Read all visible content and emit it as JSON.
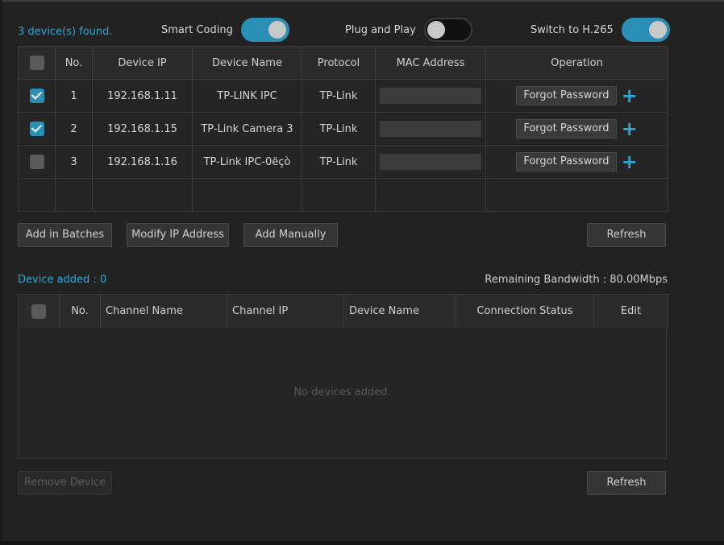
{
  "header": {
    "found_text": "3 device(s) found.",
    "toggles": [
      {
        "label": "Smart Coding",
        "state": "on"
      },
      {
        "label": "Plug and Play",
        "state": "off"
      },
      {
        "label": "Switch to H.265",
        "state": "on"
      }
    ]
  },
  "found_table": {
    "columns": [
      "No.",
      "Device IP",
      "Device Name",
      "Protocol",
      "MAC Address",
      "Operation"
    ],
    "rows": [
      {
        "checked": true,
        "no": "1",
        "ip": "192.168.1.11",
        "name": "TP-LINK IPC",
        "protocol": "TP-Link",
        "operation": "Forgot Password"
      },
      {
        "checked": true,
        "no": "2",
        "ip": "192.168.1.15",
        "name": "TP-Link Camera 3",
        "protocol": "TP-Link",
        "operation": "Forgot Password"
      },
      {
        "checked": false,
        "no": "3",
        "ip": "192.168.1.16",
        "name": "TP-Link IPC-0ëçò",
        "protocol": "TP-Link",
        "operation": "Forgot Password"
      }
    ]
  },
  "actions": {
    "add_batches": "Add in Batches",
    "modify_ip": "Modify IP Address",
    "add_manually": "Add Manually",
    "refresh": "Refresh"
  },
  "added_section": {
    "title": "Device added : 0",
    "bandwidth": "Remaining Bandwidth : 80.00Mbps",
    "columns": [
      "No.",
      "Channel Name",
      "Channel IP",
      "Device Name",
      "Connection Status",
      "Edit"
    ],
    "empty_message": "No devices added."
  },
  "bottom_actions": {
    "remove": "Remove Device",
    "refresh": "Refresh"
  },
  "colors": {
    "accent": "#2aa7d6",
    "toggle_on": "#2b8fb5",
    "background": "#222222"
  },
  "icons": {
    "checkbox": "checkbox",
    "add": "plus-icon"
  }
}
